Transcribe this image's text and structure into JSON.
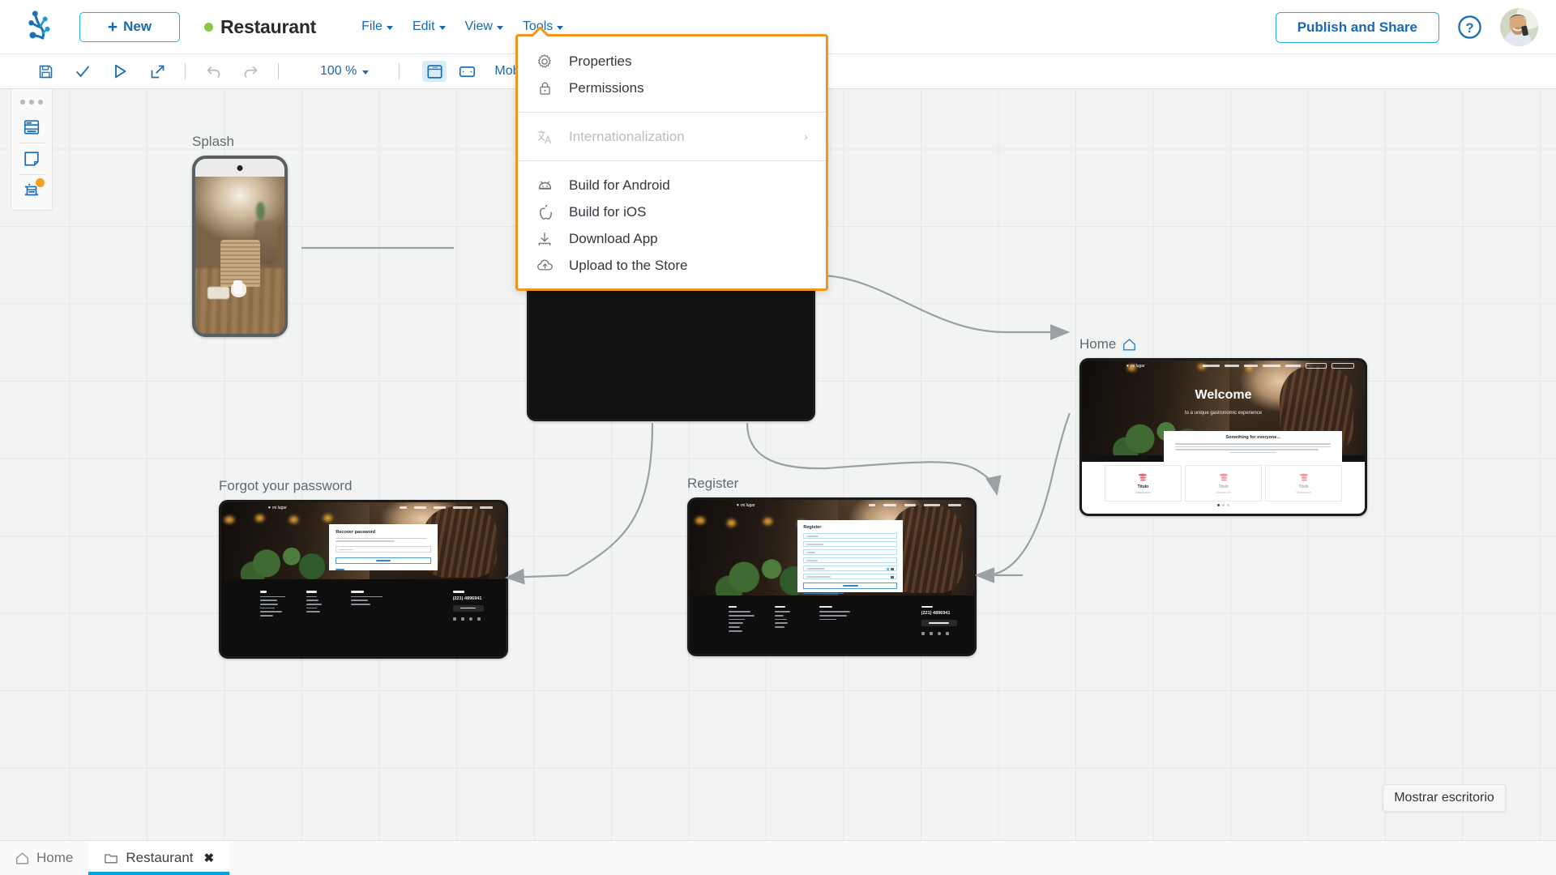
{
  "header": {
    "logo_icon": "frog-logo-icon",
    "new_button": {
      "label": "New",
      "icon": "plus-icon"
    },
    "project": {
      "status_dot_color": "#8cc63e",
      "name": "Restaurant"
    },
    "menus": [
      {
        "label": "File",
        "id": "file"
      },
      {
        "label": "Edit",
        "id": "edit"
      },
      {
        "label": "View",
        "id": "view"
      },
      {
        "label": "Tools",
        "id": "tools"
      }
    ],
    "publish_button": "Publish and Share",
    "help_icon": "question-circle-icon",
    "avatar_icon": "user-avatar"
  },
  "toolbar": {
    "save_icon": "save-icon",
    "validate_icon": "check-icon",
    "run_icon": "play-icon",
    "open_icon": "external-link-icon",
    "zoom_level": "100 %",
    "view_desktop_icon": "desktop-view-icon",
    "view_tablet_icon": "tablet-view-icon",
    "view_mobile_label": "Mobile"
  },
  "left_panel": {
    "handle_icon": "drag-dots-icon",
    "items": [
      {
        "id": "layers",
        "icon": "layers-panel-icon",
        "badge": false
      },
      {
        "id": "pages",
        "icon": "page-icon",
        "badge": false
      },
      {
        "id": "components",
        "icon": "component-icon",
        "badge": true,
        "badge_color": "#f5a01e"
      }
    ]
  },
  "tools_menu": {
    "border_color": "#f0961e",
    "items": [
      {
        "label": "Properties",
        "icon": "gear-icon",
        "disabled": false,
        "submenu": false
      },
      {
        "label": "Permissions",
        "icon": "lock-icon",
        "disabled": false,
        "submenu": false
      },
      {
        "separator": true
      },
      {
        "label": "Internationalization",
        "icon": "translate-icon",
        "disabled": true,
        "submenu": true
      },
      {
        "separator": true
      },
      {
        "label": "Build for Android",
        "icon": "android-icon",
        "disabled": false,
        "submenu": false
      },
      {
        "label": "Build for iOS",
        "icon": "apple-icon",
        "disabled": false,
        "submenu": false
      },
      {
        "label": "Download App",
        "icon": "download-icon",
        "disabled": false,
        "submenu": false
      },
      {
        "label": "Upload to the Store",
        "icon": "cloud-upload-icon",
        "disabled": false,
        "submenu": false
      }
    ]
  },
  "canvas": {
    "nodes": [
      {
        "id": "splash",
        "label": "Splash",
        "type": "phone",
        "is_home": false
      },
      {
        "id": "login",
        "label": "",
        "type": "desktop",
        "is_home": false
      },
      {
        "id": "home",
        "label": "Home",
        "type": "desktop",
        "is_home": true,
        "home_icon": "home-outline-icon"
      },
      {
        "id": "forgot",
        "label": "Forgot your password",
        "type": "desktop",
        "is_home": false
      },
      {
        "id": "register",
        "label": "Register",
        "type": "desktop",
        "is_home": false
      }
    ]
  },
  "screens": {
    "home": {
      "brand": "mi lugar",
      "hero_title": "Welcome",
      "hero_subtitle": "to a unique gastronomic experience",
      "card_title": "Something for everyone...",
      "card_body": "Bienvenido a Mi Lugar, donde viviras una experiencia gastronomica unica con el sabor especial de la cocina del noroeste. Ya sea que estes agu solo o al almuerzo o cena de negocios, celebrar una ocasion especial o buscar un ambiente romantico para una cita, nuestro menu ofrece algo para todos.",
      "tiles": [
        {
          "title": "Titulo",
          "subtitle": "Descripcion"
        },
        {
          "title": "Titulo",
          "subtitle": "Descripcion"
        },
        {
          "title": "Titulo",
          "subtitle": "Descripcion"
        }
      ],
      "nav": [
        "Us",
        "Menu",
        "Events",
        "Reservations",
        "Contact"
      ],
      "nav_buttons": [
        "Ingresar",
        "Registrarse"
      ]
    },
    "forgot": {
      "brand": "mi lugar",
      "form_title": "Recover password",
      "form_help": "Ingresa la direccion de correo electronico y te enviaremos a red nueva contrasena.",
      "field_email": "Email",
      "submit_label": "Next",
      "back_link": "Back",
      "nav": [
        "Us",
        "Menu",
        "Events",
        "Reservations",
        "Contact"
      ],
      "footer": {
        "columns": [
          {
            "heading": "Us",
            "links": [
              "The restaurant",
              "Our story",
              "The team",
              "Careers",
              "Scholarships",
              "Awards"
            ]
          },
          {
            "heading": "Menus",
            "links": [
              "Lunch",
              "Dinner",
              "Desserts",
              "Drinks",
              "Children"
            ]
          },
          {
            "heading": "Contact",
            "links": [
              "Special Reservations",
              "Gift cards",
              "Reservations"
            ]
          }
        ],
        "call_heading": "Call us",
        "phone": "(221) 4896941",
        "book_button": "Book now"
      }
    },
    "register": {
      "brand": "mi lugar",
      "form_title": "Register",
      "fields": [
        "Name",
        "Last Name",
        "DNI",
        "Email",
        "Password",
        "Repeat Password"
      ],
      "submit_label": "Register",
      "login_link": "¿Ya tienes una cuenta? Ingresa",
      "nav": [
        "Us",
        "Menu",
        "Events",
        "Reservations",
        "Contact"
      ],
      "footer": {
        "columns": [
          {
            "heading": "Ours",
            "links": [
              "El Toldo Azul",
              "Nuestra Historia",
              "El equipo",
              "Carreras",
              "Becas",
              "Premios"
            ]
          },
          {
            "heading": "Menus",
            "links": [
              "Almuerzo",
              "Cena",
              "Postres",
              "Bebidas",
              "Ninos"
            ]
          },
          {
            "heading": "Contact",
            "links": [
              "Reservas Especiales",
              "Tarjetas de Regalo",
              "Reservas"
            ]
          }
        ],
        "call_heading": "Call us",
        "phone": "(221) 4896941",
        "book_button": "Reserva ahora"
      }
    }
  },
  "tooltip": {
    "text": "Mostrar escritorio"
  },
  "bottom_tabs": [
    {
      "label": "Home",
      "icon": "home-outline-icon",
      "active": false,
      "closable": false
    },
    {
      "label": "Restaurant",
      "icon": "folder-icon",
      "active": true,
      "closable": true,
      "close_icon": "close-icon"
    }
  ]
}
